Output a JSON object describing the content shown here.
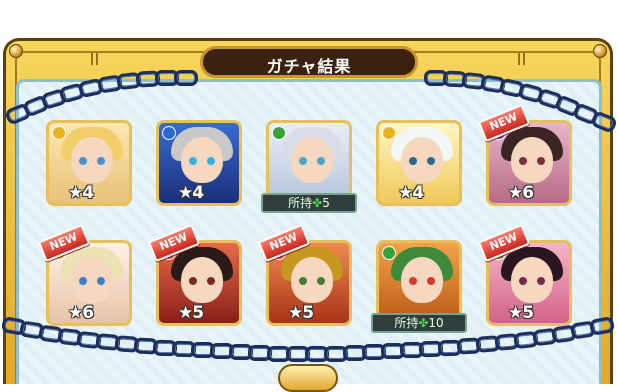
{
  "title": "ガチャ結果",
  "results": [
    {
      "rarity": "★4",
      "element": "light",
      "owned": "",
      "is_new": false
    },
    {
      "rarity": "★4",
      "element": "water",
      "owned": "",
      "is_new": false
    },
    {
      "rarity": "",
      "element": "wood",
      "owned": "所持",
      "owned_count": "5",
      "is_new": false
    },
    {
      "rarity": "★4",
      "element": "light",
      "owned": "",
      "is_new": false
    },
    {
      "rarity": "★6",
      "element": "dark",
      "owned": "",
      "is_new": true
    },
    {
      "rarity": "★6",
      "element": "light",
      "owned": "",
      "is_new": true
    },
    {
      "rarity": "★5",
      "element": "fire",
      "owned": "",
      "is_new": true
    },
    {
      "rarity": "★5",
      "element": "fire",
      "owned": "",
      "is_new": true
    },
    {
      "rarity": "",
      "element": "wood",
      "owned": "所持",
      "owned_count": "10",
      "is_new": false
    },
    {
      "rarity": "★5",
      "element": "wood",
      "owned": "",
      "is_new": true
    }
  ],
  "new_label": "NEW",
  "clover_icon": "✤",
  "colors": {
    "frame": "#e3a826",
    "panel": "#e9f5f9",
    "title_bg": "#3a2110",
    "chain": "#1e2e5a"
  }
}
